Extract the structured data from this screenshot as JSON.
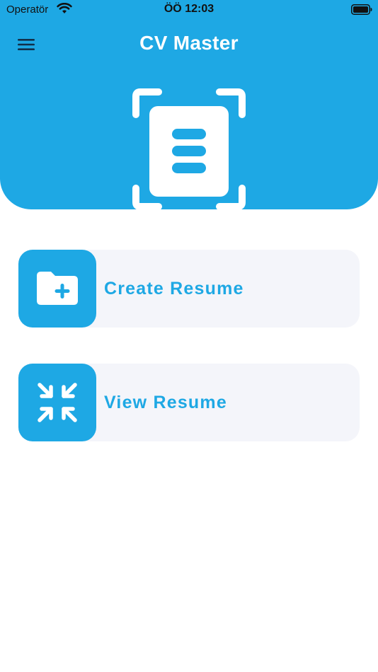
{
  "status_bar": {
    "carrier": "Operatör",
    "time": "ÖÖ 12:03",
    "wifi_icon": "wifi-icon",
    "battery_icon": "battery-icon"
  },
  "header": {
    "title": "CV Master",
    "menu_icon": "hamburger-menu-icon",
    "logo_icon": "document-scan-icon",
    "background_color": "#1ea8e4"
  },
  "actions": [
    {
      "label": "Create Resume",
      "icon": "folder-add-icon"
    },
    {
      "label": "View Resume",
      "icon": "arrows-collapse-icon"
    }
  ],
  "colors": {
    "accent": "#1ea8e4",
    "card_background": "#f4f5fa",
    "page_background": "#ffffff"
  }
}
